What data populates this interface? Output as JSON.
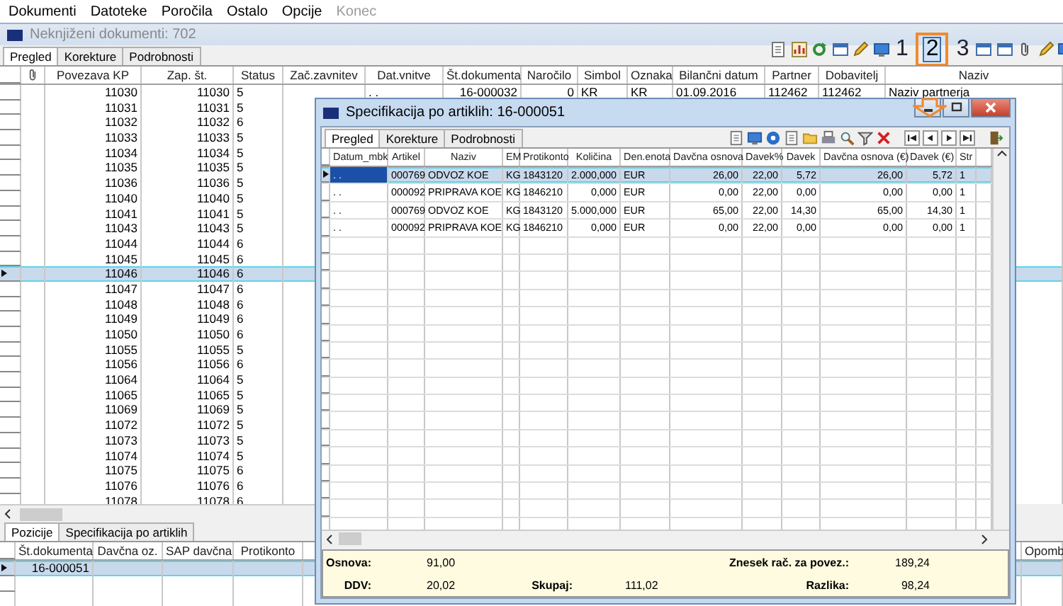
{
  "menu": [
    {
      "label": "Dokumenti",
      "disabled": false
    },
    {
      "label": "Datoteke",
      "disabled": false
    },
    {
      "label": "Poročila",
      "disabled": false
    },
    {
      "label": "Ostalo",
      "disabled": false
    },
    {
      "label": "Opcije",
      "disabled": false
    },
    {
      "label": "Konec",
      "disabled": true
    }
  ],
  "window": {
    "title": "Neknjiženi dokumenti: 702"
  },
  "tabs": [
    {
      "label": "Pregled",
      "selected": true
    },
    {
      "label": "Korekture",
      "selected": false
    },
    {
      "label": "Podrobnosti",
      "selected": false
    }
  ],
  "toolbar": {
    "views": [
      {
        "label": "1",
        "selected": false
      },
      {
        "label": "2",
        "selected": true
      },
      {
        "label": "3",
        "selected": false
      }
    ]
  },
  "table": {
    "columns": [
      "Povezava KP",
      "Zap. št.",
      "Status",
      "Zač.zavnitev",
      "Dat.vnitve",
      "Št.dokumenta",
      "Naročilo",
      "Simbol",
      "Oznaka",
      "Bilančni datum",
      "Partner",
      "Dobavitelj",
      "Naziv"
    ],
    "rows": [
      {
        "cells": [
          "11030",
          "11030",
          "5",
          null,
          ". .",
          "16-000032",
          "0",
          "KR",
          "KR",
          "01.09.2016",
          "112462",
          "112462",
          "Naziv partnerja"
        ],
        "selected": false
      },
      {
        "cells": [
          "11031",
          "11031",
          "5"
        ],
        "selected": false
      },
      {
        "cells": [
          "11032",
          "11032",
          "6"
        ],
        "selected": false
      },
      {
        "cells": [
          "11033",
          "11033",
          "5"
        ],
        "selected": false
      },
      {
        "cells": [
          "11034",
          "11034",
          "5"
        ],
        "selected": false
      },
      {
        "cells": [
          "11035",
          "11035",
          "5"
        ],
        "selected": false
      },
      {
        "cells": [
          "11036",
          "11036",
          "5"
        ],
        "selected": false
      },
      {
        "cells": [
          "11040",
          "11040",
          "5"
        ],
        "selected": false
      },
      {
        "cells": [
          "11041",
          "11041",
          "5"
        ],
        "selected": false
      },
      {
        "cells": [
          "11043",
          "11043",
          "5"
        ],
        "selected": false
      },
      {
        "cells": [
          "11044",
          "11044",
          "6"
        ],
        "selected": false
      },
      {
        "cells": [
          "11045",
          "11045",
          "6"
        ],
        "selected": false
      },
      {
        "cells": [
          "11046",
          "11046",
          "6"
        ],
        "selected": true
      },
      {
        "cells": [
          "11047",
          "11047",
          "6"
        ],
        "selected": false
      },
      {
        "cells": [
          "11048",
          "11048",
          "6"
        ],
        "selected": false
      },
      {
        "cells": [
          "11049",
          "11049",
          "6"
        ],
        "selected": false
      },
      {
        "cells": [
          "11050",
          "11050",
          "6"
        ],
        "selected": false
      },
      {
        "cells": [
          "11055",
          "11055",
          "5"
        ],
        "selected": false
      },
      {
        "cells": [
          "11056",
          "11056",
          "6"
        ],
        "selected": false
      },
      {
        "cells": [
          "11064",
          "11064",
          "5"
        ],
        "selected": false
      },
      {
        "cells": [
          "11065",
          "11065",
          "5"
        ],
        "selected": false
      },
      {
        "cells": [
          "11069",
          "11069",
          "5"
        ],
        "selected": false
      },
      {
        "cells": [
          "11072",
          "11072",
          "5"
        ],
        "selected": false
      },
      {
        "cells": [
          "11073",
          "11073",
          "5"
        ],
        "selected": false
      },
      {
        "cells": [
          "11074",
          "11074",
          "5"
        ],
        "selected": false
      },
      {
        "cells": [
          "11075",
          "11075",
          "6"
        ],
        "selected": false
      },
      {
        "cells": [
          "11076",
          "11076",
          "6"
        ],
        "selected": false
      },
      {
        "cells": [
          "11078",
          "11078",
          "6"
        ],
        "selected": false
      }
    ]
  },
  "bottom": {
    "tabs": [
      {
        "label": "Pozicije",
        "selected": true
      },
      {
        "label": "Specifikacija po artiklih",
        "selected": false
      }
    ],
    "columns": [
      "Št.dokumenta",
      "Davčna oz.",
      "SAP davčna",
      "Protikonto",
      "Opomb"
    ],
    "rows": [
      {
        "cells": [
          "16-000051"
        ],
        "selected": true
      }
    ]
  },
  "dialog": {
    "title": "Specifikacija po artiklih: 16-000051",
    "tabs": [
      {
        "label": "Pregled",
        "selected": true
      },
      {
        "label": "Korekture",
        "selected": false
      },
      {
        "label": "Podrobnosti",
        "selected": false
      }
    ],
    "columns": [
      "Datum_mbk",
      "Artikel",
      "Naziv",
      "EM",
      "Protikonto",
      "Količina",
      "Den.enota",
      "Davčna osnova",
      "Davek%",
      "Davek",
      "Davčna osnova (€)",
      "Davek (€)",
      "Str"
    ],
    "rows": [
      {
        "cells": [
          ". .",
          "000769",
          "ODVOZ KOE",
          "KG",
          "1843120",
          "2.000,000",
          "EUR",
          "26,00",
          "22,00",
          "5,72",
          "26,00",
          "5,72",
          "1"
        ],
        "selected": true
      },
      {
        "cells": [
          ". .",
          "000092",
          "PRIPRAVA KOE",
          "KG",
          "1846210",
          "0,000",
          "EUR",
          "0,00",
          "22,00",
          "0,00",
          "0,00",
          "0,00",
          "1"
        ],
        "selected": false
      },
      {
        "cells": [
          ". .",
          "000769",
          "ODVOZ KOE",
          "KG",
          "1843120",
          "5.000,000",
          "EUR",
          "65,00",
          "22,00",
          "14,30",
          "65,00",
          "14,30",
          "1"
        ],
        "selected": false
      },
      {
        "cells": [
          ". .",
          "000092",
          "PRIPRAVA KOE",
          "KG",
          "1846210",
          "0,000",
          "EUR",
          "0,00",
          "22,00",
          "0,00",
          "0,00",
          "0,00",
          "1"
        ],
        "selected": false
      }
    ],
    "summary": {
      "osnova": {
        "label": "Osnova:",
        "value": "91,00"
      },
      "znesek": {
        "label": "Znesek rač. za povez.:",
        "value": "189,24"
      },
      "ddv": {
        "label": "DDV:",
        "value": "20,02"
      },
      "skupaj": {
        "label": "Skupaj:",
        "value": "111,02"
      },
      "razlika": {
        "label": "Razlika:",
        "value": "98,24"
      }
    }
  }
}
